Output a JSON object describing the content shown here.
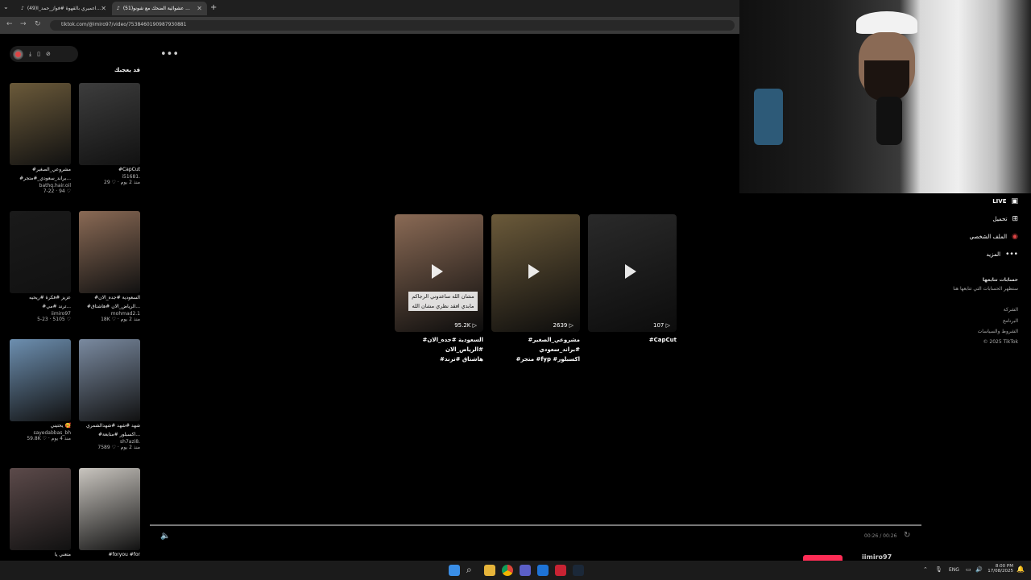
{
  "browser": {
    "tabs": [
      {
        "label": "(49)اعميري بالقهوة #فواز_حمد_ا..."
      },
      {
        "label": "(51)عشوائية الضحك مع شونو ..."
      }
    ],
    "new_tab": "+",
    "url": "tiktok.com/@imiro97/video/7538460190987930881"
  },
  "left": {
    "section_title": "قد يعجبك",
    "cards": [
      {
        "caption": "#مشروعي_الصغير",
        "caption2": "#براند_سعودي_#متجر...",
        "author": "bathq.hair.oil",
        "meta": "7-22 · 94 ♡",
        "bg": "#6b5a3a"
      },
      {
        "caption": "#CapCut",
        "caption2": "",
        "author": "i51681.",
        "meta": "29 ♡ · منذ 2 يوم",
        "bg": "#3d3d3d"
      },
      {
        "caption": "عزيز #فكرة #ريحيه",
        "caption2": "#ترند #مي...",
        "author": "iimiro97",
        "meta": "5-23 · 5105 ♡",
        "bg": "#1a1a1a"
      },
      {
        "caption": "#السعودية #جده_الان",
        "caption2": "#الرياض_الان #هاشتاق...",
        "author": "mohmad2.1",
        "meta": "18K ♡ · منذ 2 يوم",
        "bg": "#8a6a55"
      },
      {
        "caption": "يحتيني 🥰",
        "caption2": "",
        "author": "sayedabbas_bh",
        "meta": "59.8K ♡ · منذ 4 يوم",
        "bg": "#6d8fb0"
      },
      {
        "caption": "شهد #شهد #شهدالشمري",
        "caption2": "#اكسبلور #متابعة...",
        "author": "sh7azi8.",
        "meta": "7589 ♡ · منذ 2 يوم",
        "bg": "#7a8aa0"
      },
      {
        "caption": "متعني يا",
        "caption2": "",
        "author": "",
        "meta": "",
        "bg": "#5c4a4a"
      },
      {
        "caption": "#foryou #for",
        "caption2": "",
        "author": "",
        "meta": "",
        "bg": "#c9c5bf"
      }
    ]
  },
  "main": {
    "more": "•••",
    "videos": [
      {
        "count": "95.2K",
        "caption": "#السعودية #جده_الان #الرياض_الان",
        "caption2": "#هاشتاق #ترند",
        "overlay": "مشان الله ساعدوني الرجاكم\nمابدي افقد نظري مشان الله",
        "bg": "#8a6a55"
      },
      {
        "count": "2639",
        "caption": "#مشروعي_الصغير #براند_سعودي",
        "caption2": "#متجر #fyp #اكسبلور",
        "overlay": "",
        "bg": "#6b5a3a"
      },
      {
        "count": "107",
        "caption": "#CapCut",
        "caption2": "",
        "overlay": "",
        "bg": "#2a2a2a"
      }
    ],
    "time": "00:26 / 00:26",
    "account": "iimiro97"
  },
  "right": {
    "nav": [
      {
        "label": "LIVE",
        "icon": "▣"
      },
      {
        "label": "تحميل",
        "icon": "⊞"
      },
      {
        "label": "الملف الشخصي",
        "icon": "◉"
      },
      {
        "label": "المزيد",
        "icon": "•••"
      }
    ],
    "following_title": "حسابات تتابعها",
    "following_sub": "ستظهر الحسابات التي تتابعها هنا",
    "footer": [
      "الشركة",
      "البرنامج",
      "الشروط والسياسات",
      "© 2025 TikTok"
    ]
  },
  "taskbar": {
    "lang": "ENG",
    "time": "8:00 PM",
    "date": "17/08/2025"
  },
  "colors": {
    "accent": "#fe2c55",
    "bg": "#000000"
  }
}
